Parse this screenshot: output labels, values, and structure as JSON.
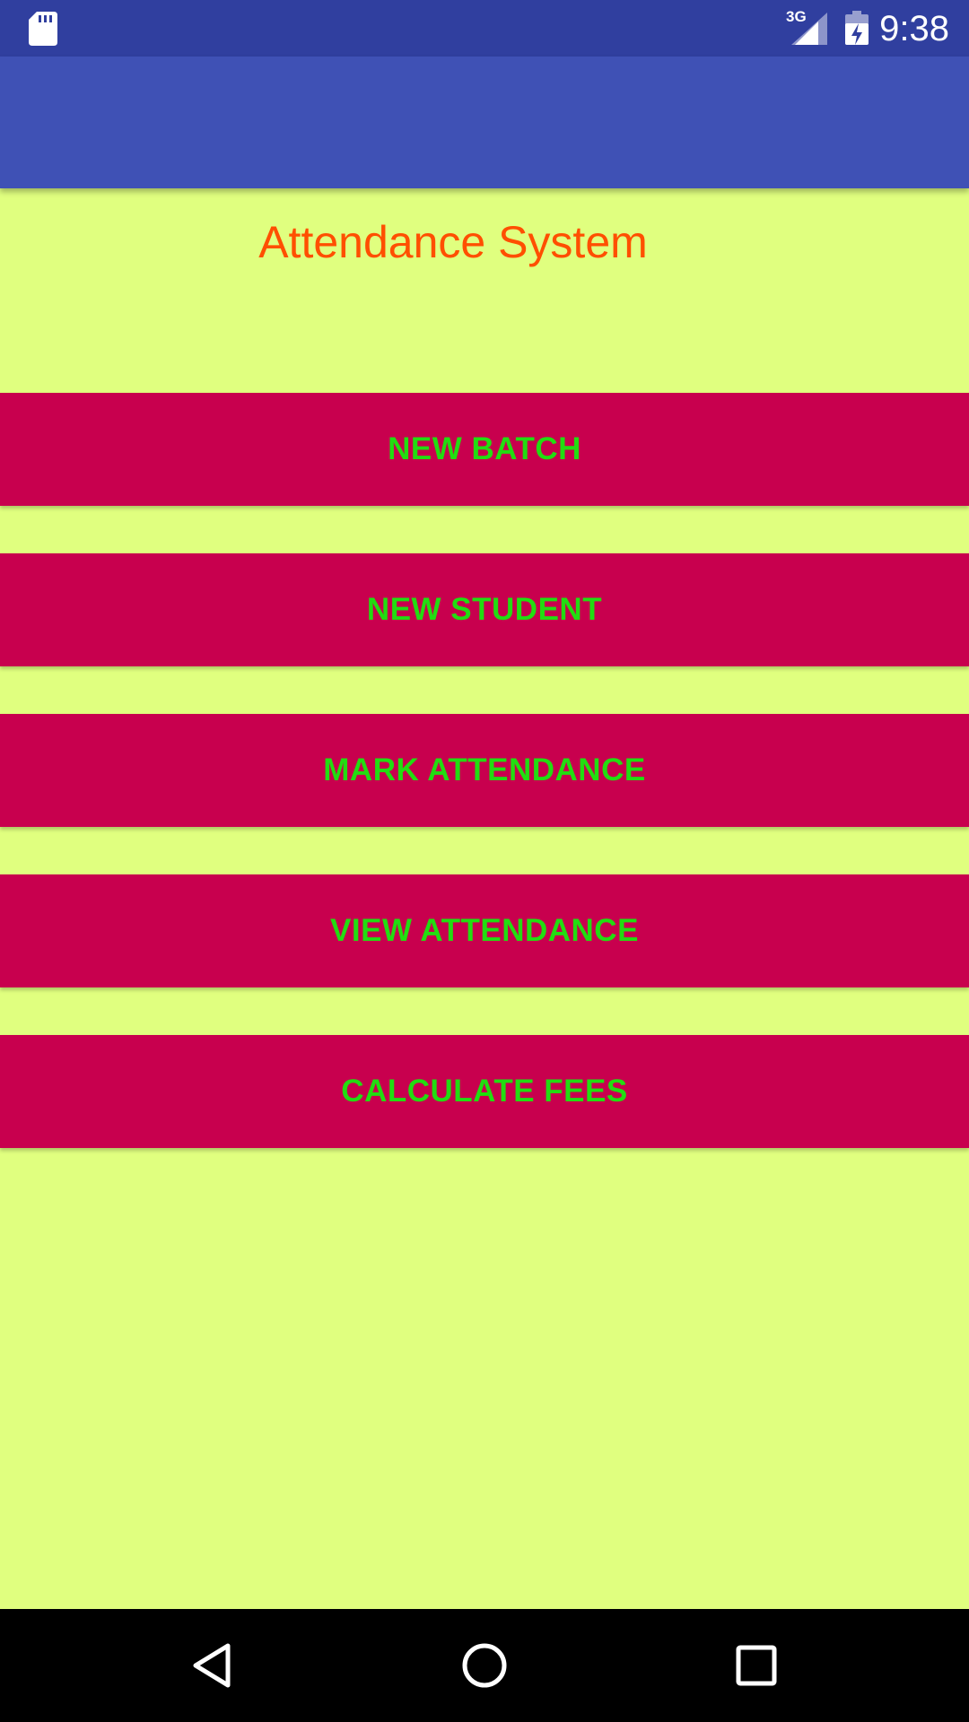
{
  "status_bar": {
    "network_type": "3G",
    "time": "9:38",
    "icons": [
      "sd-card-icon",
      "cellular-signal-icon",
      "battery-charging-icon"
    ]
  },
  "main": {
    "title": "Attendance System",
    "buttons": [
      {
        "label": "NEW BATCH"
      },
      {
        "label": "NEW STUDENT"
      },
      {
        "label": "MARK ATTENDANCE"
      },
      {
        "label": "VIEW ATTENDANCE"
      },
      {
        "label": "CALCULATE FEES"
      }
    ]
  },
  "nav_bar": {
    "icons": [
      "back-icon",
      "home-icon",
      "recents-icon"
    ]
  },
  "colors": {
    "status_bar": "#303f9f",
    "app_bar": "#3f51b5",
    "background": "#e0ff7f",
    "title_text": "#ff4f00",
    "button_background": "#c8004e",
    "button_text": "#22dd11",
    "nav_bar": "#000000"
  }
}
